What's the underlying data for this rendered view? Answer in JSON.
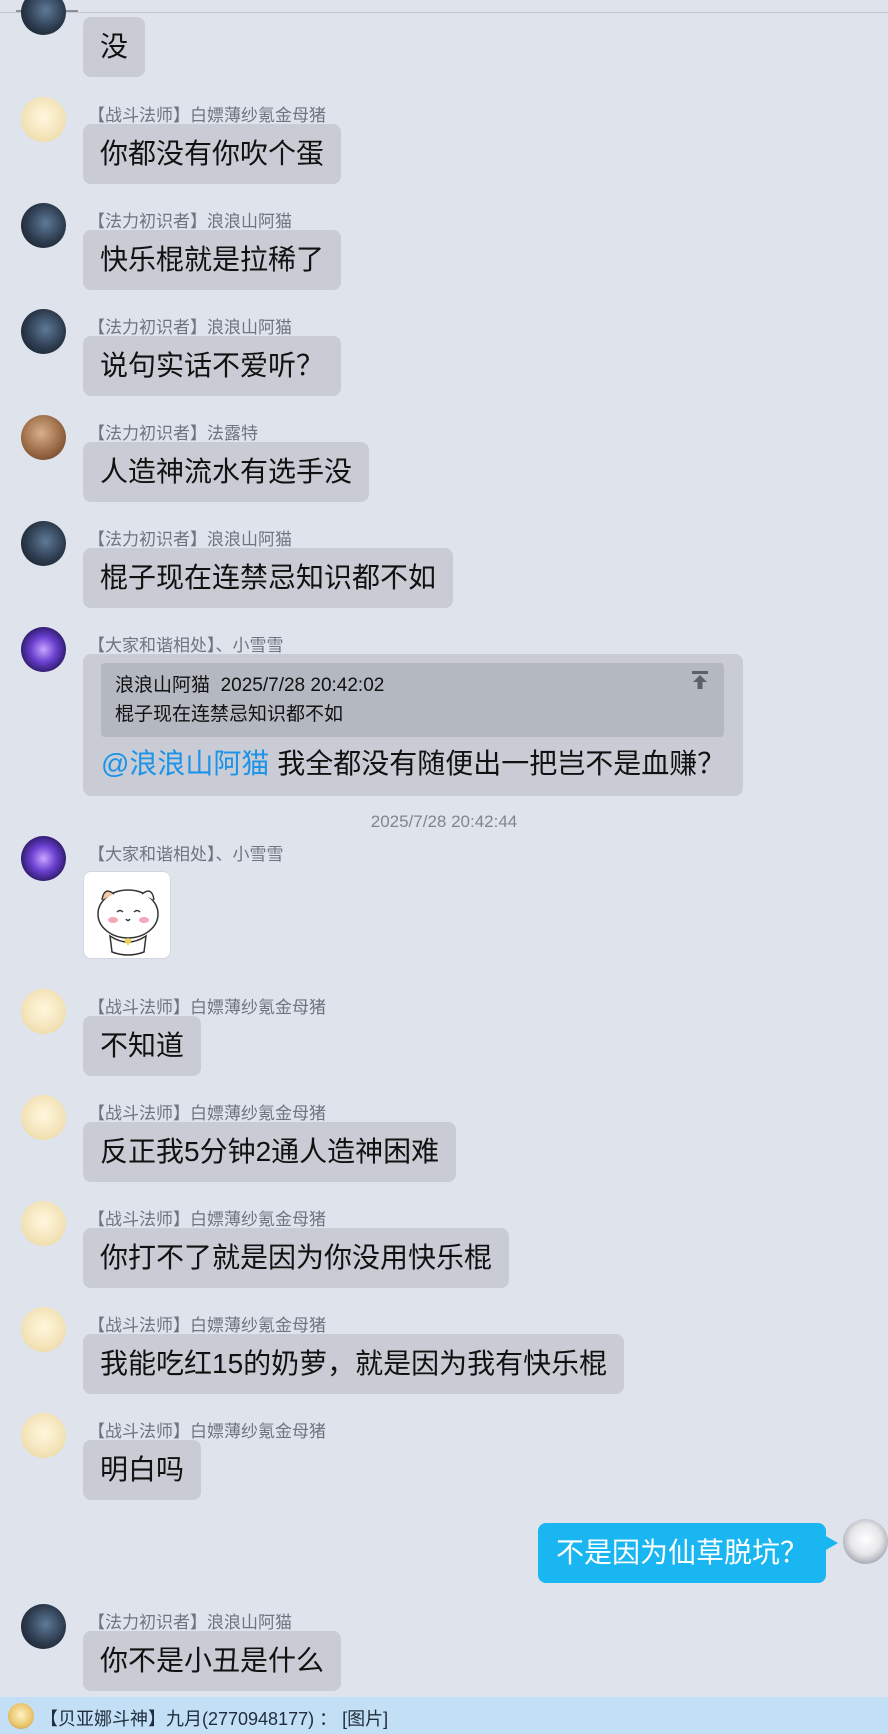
{
  "messages": [
    {
      "sender": "",
      "text": "没"
    },
    {
      "sender": "【战斗法师】白嫖薄纱氪金母猪",
      "text": "你都没有你吹个蛋"
    },
    {
      "sender": "【法力初识者】浪浪山阿猫",
      "text": "快乐棍就是拉稀了"
    },
    {
      "sender": "【法力初识者】浪浪山阿猫",
      "text": "说句实话不爱听？"
    },
    {
      "sender": "【法力初识者】法露特",
      "text": "人造神流水有选手没"
    },
    {
      "sender": "【法力初识者】浪浪山阿猫",
      "text": "棍子现在连禁忌知识都不如"
    },
    {
      "sender": "【大家和谐相处】、小雪雪",
      "quote": {
        "author": "浪浪山阿猫",
        "time": "2025/7/28 20:42:02",
        "text": "棍子现在连禁忌知识都不如"
      },
      "mention": "@浪浪山阿猫",
      "text": " 我全都没有随便出一把岂不是血赚？"
    },
    {
      "sender": "【大家和谐相处】、小雪雪",
      "sticker": true
    },
    {
      "sender": "【战斗法师】白嫖薄纱氪金母猪",
      "text": "不知道"
    },
    {
      "sender": "【战斗法师】白嫖薄纱氪金母猪",
      "text": "反正我5分钟2通人造神困难"
    },
    {
      "sender": "【战斗法师】白嫖薄纱氪金母猪",
      "text": "你打不了就是因为你没用快乐棍"
    },
    {
      "sender": "【战斗法师】白嫖薄纱氪金母猪",
      "text": "我能吃红15的奶萝，就是因为我有快乐棍"
    },
    {
      "sender": "【战斗法师】白嫖薄纱氪金母猪",
      "text": "明白吗"
    },
    {
      "sender": "me",
      "text": "不是因为仙草脱坑？"
    },
    {
      "sender": "【法力初识者】浪浪山阿猫",
      "text": "你不是小丑是什么"
    }
  ],
  "timestamp": "2025/7/28 20:42:44",
  "notice": {
    "text": "【贝亚娜斗神】九月(2770948177) ： [图片]"
  }
}
